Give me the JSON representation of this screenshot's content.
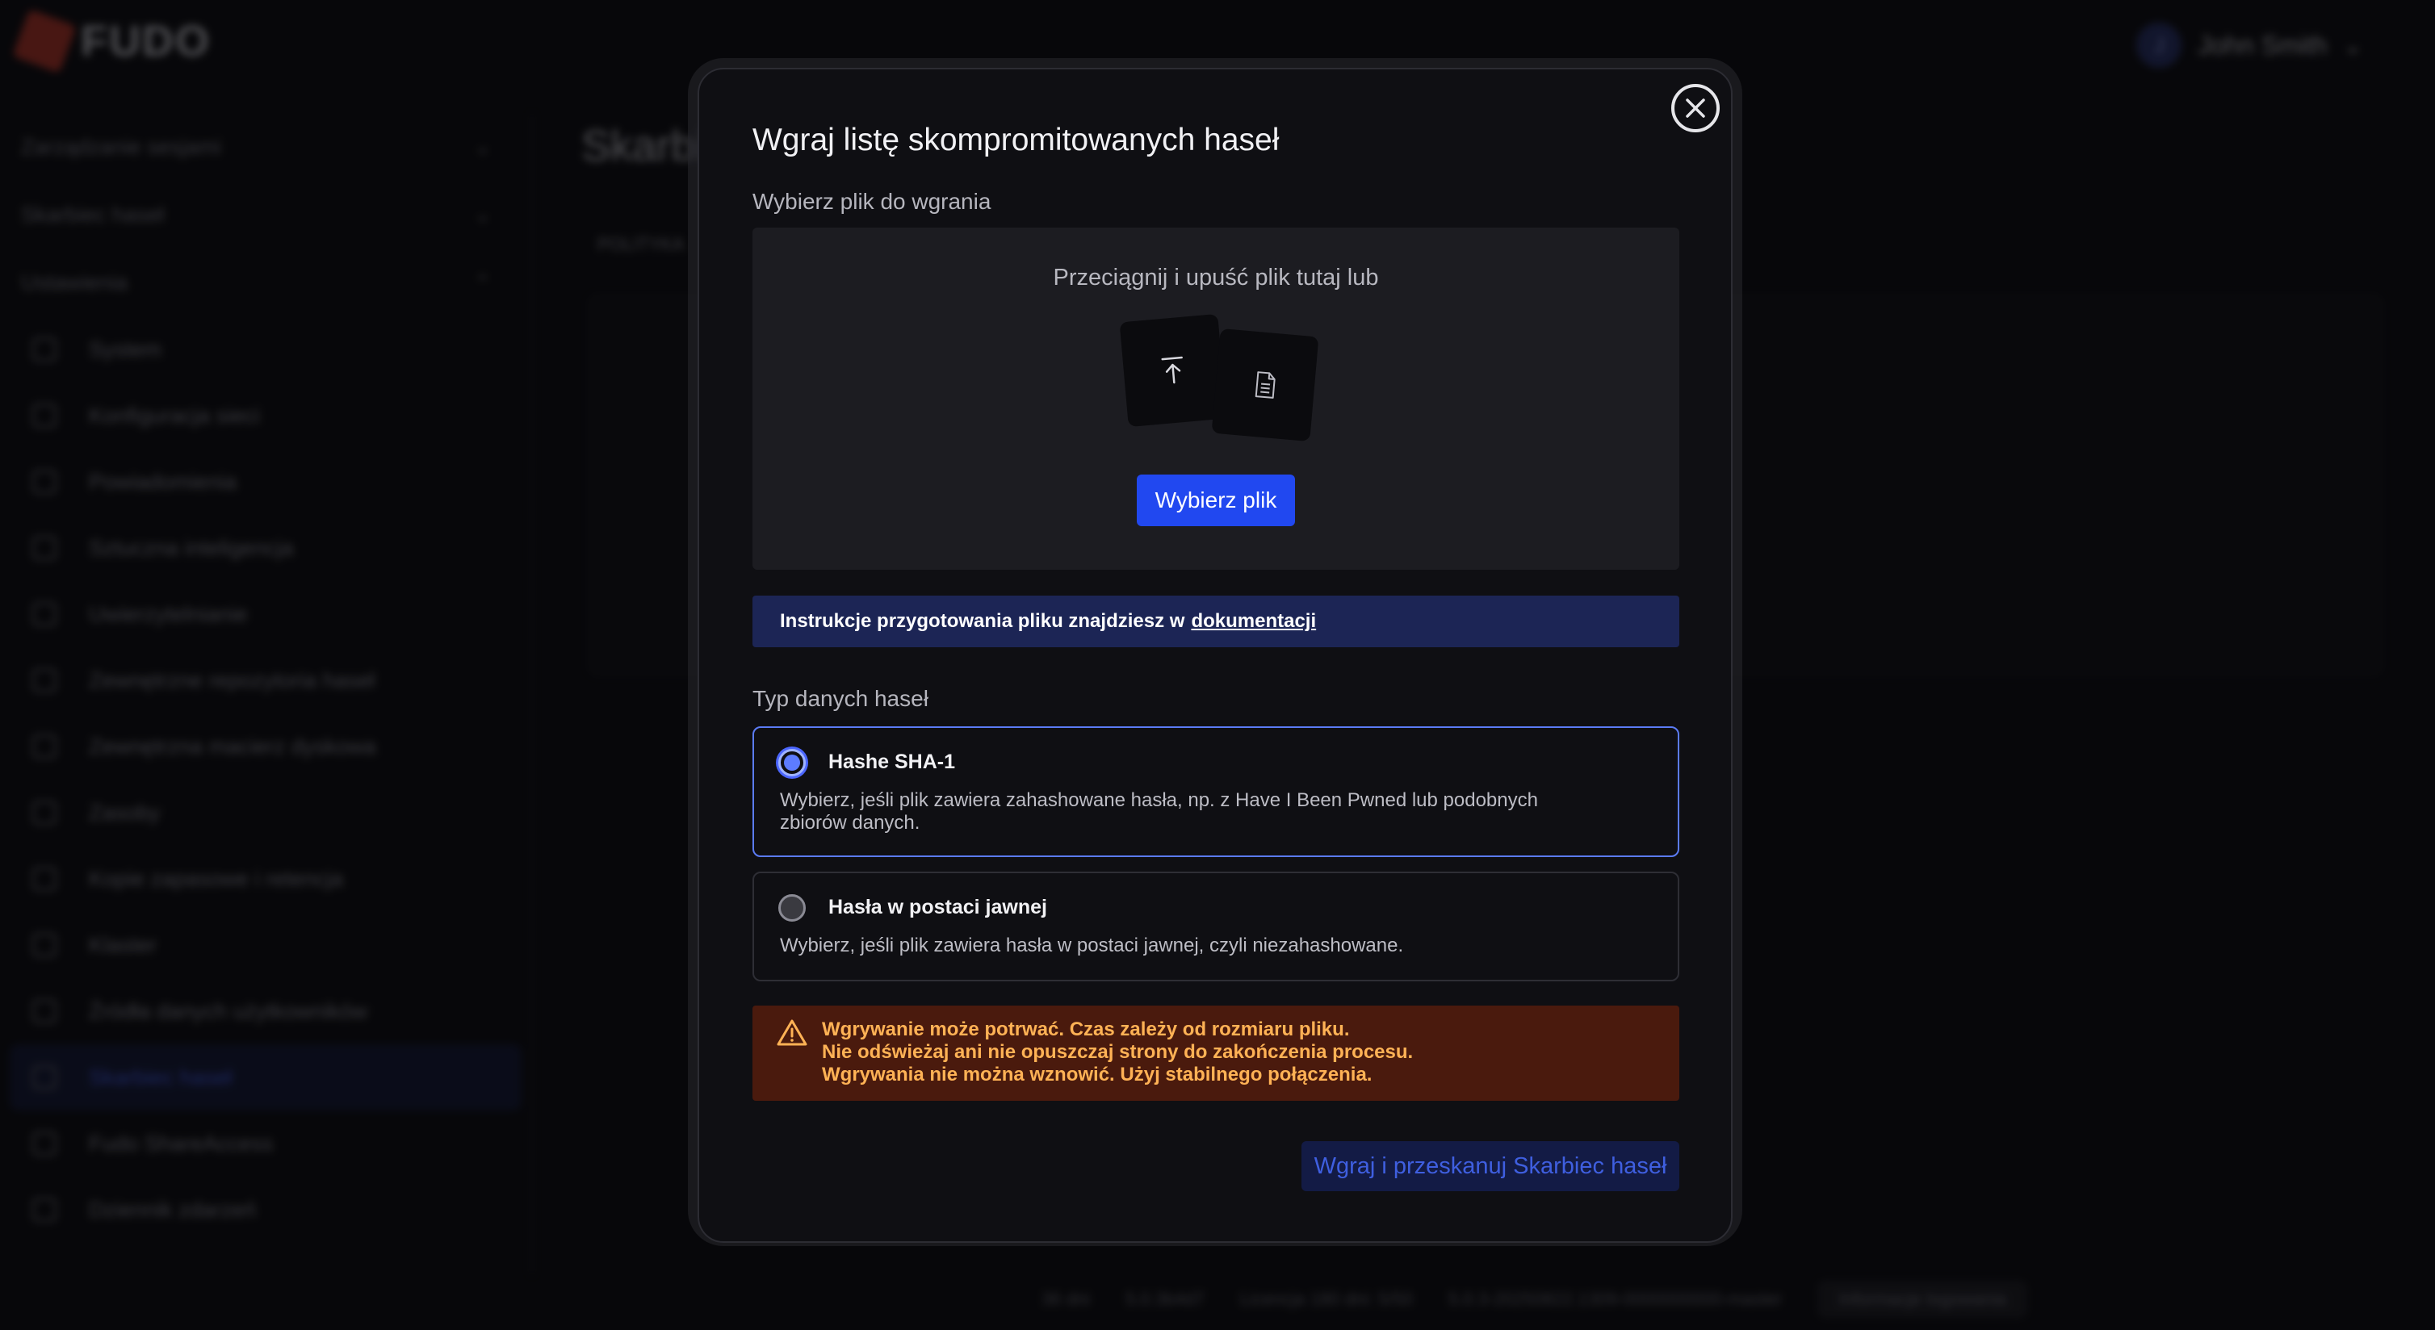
{
  "app": {
    "logo_text": "FUDO",
    "user_initial": "J",
    "user_name": "John Smith",
    "sidebar_groups": [
      "Zarządzanie sesjami",
      "Skarbiec haseł",
      "Ustawienia"
    ],
    "sidebar_items": [
      {
        "label": "System",
        "icon": "gear-icon"
      },
      {
        "label": "Konfiguracja sieci",
        "icon": "network-icon"
      },
      {
        "label": "Powiadomienia",
        "icon": "bell-icon"
      },
      {
        "label": "Sztuczna inteligencja",
        "icon": "ai-icon"
      },
      {
        "label": "Uwierzytelnianie",
        "icon": "lock-icon"
      },
      {
        "label": "Zewnętrzne repozytoria haseł",
        "icon": "key-icon"
      },
      {
        "label": "Zewnętrzna macierz dyskowa",
        "icon": "disk-icon"
      },
      {
        "label": "Zasoby",
        "icon": "folder-icon"
      },
      {
        "label": "Kopie zapasowe i retencja",
        "icon": "backup-icon"
      },
      {
        "label": "Klaster",
        "icon": "cluster-icon"
      },
      {
        "label": "Źródła danych użytkowników",
        "icon": "database-icon"
      },
      {
        "label": "Skarbiec haseł",
        "icon": "vault-icon",
        "active": true
      },
      {
        "label": "Fudo ShareAccess",
        "icon": "share-icon"
      },
      {
        "label": "Dziennik zdarzeń",
        "icon": "log-icon"
      }
    ],
    "main_title": "Skarbi",
    "main_tab": "POLITYKA",
    "status": [
      "36 dni",
      "5.0.3b4d7",
      "Licencja 180 dni: 5/50",
      "5.0.3-20250822.1309-0000000000-master"
    ],
    "status_pill": "Informacje logowania"
  },
  "modal": {
    "title": "Wgraj listę skompromitowanych haseł",
    "file_label": "Wybierz plik do wgrania",
    "drop_text": "Przeciągnij i upuść plik tutaj lub",
    "choose_button": "Wybierz plik",
    "info_text": "Instrukcje przygotowania pliku znajdziesz w",
    "info_link": "dokumentacji",
    "type_label": "Typ danych haseł",
    "options": [
      {
        "title": "Hashe SHA-1",
        "desc": "Wybierz, jeśli plik zawiera zahashowane hasła, np. z Have I Been Pwned lub podobnych zbiorów danych.",
        "selected": true
      },
      {
        "title": "Hasła w postaci jawnej",
        "desc": "Wybierz, jeśli plik zawiera hasła w postaci jawnej, czyli niezahashowane.",
        "selected": false
      }
    ],
    "warning_lines": [
      "Wgrywanie może potrwać. Czas zależy od rozmiaru pliku.",
      "Nie odświeżaj ani nie opuszczaj strony do zakończenia procesu.",
      "Wgrywania nie można wznowić. Użyj stabilnego połączenia."
    ],
    "submit_button": "Wgraj i przeskanuj Skarbiec haseł"
  },
  "colors": {
    "accent": "#2148f0",
    "selected_border": "#5b7bf5",
    "warning_bg": "#4a1a0d",
    "warning_text": "#ffb255",
    "info_bg": "#1c2555"
  }
}
